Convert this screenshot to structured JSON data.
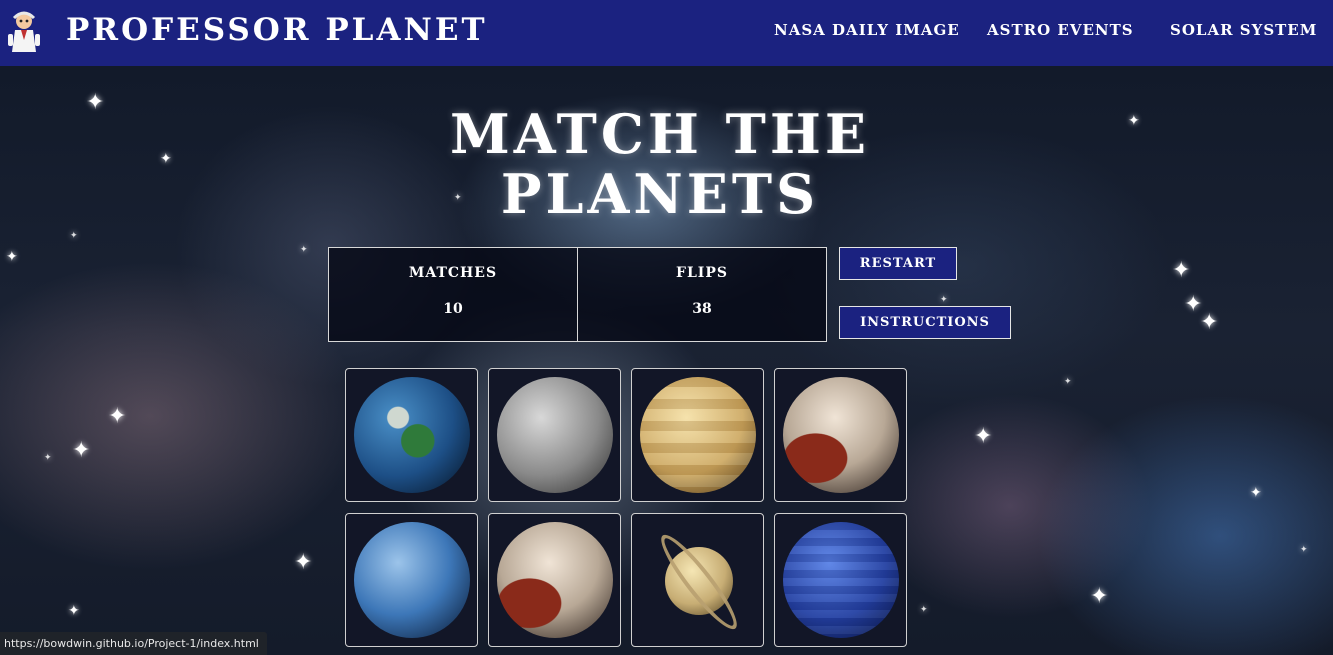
{
  "nav": {
    "brand": "PROFESSOR PLANET",
    "links": [
      "NASA DAILY IMAGE",
      "ASTRO EVENTS",
      "SOLAR SYSTEM"
    ]
  },
  "game": {
    "title_line1": "MATCH THE",
    "title_line2": "PLANETS",
    "matches_label": "MATCHES",
    "matches_value": "10",
    "flips_label": "FLIPS",
    "flips_value": "38",
    "restart_label": "RESTART",
    "instructions_label": "INSTRUCTIONS"
  },
  "cards": [
    {
      "planet": "earth"
    },
    {
      "planet": "moon"
    },
    {
      "planet": "venus"
    },
    {
      "planet": "pluto"
    },
    {
      "planet": "neptune"
    },
    {
      "planet": "pluto"
    },
    {
      "planet": "saturn"
    },
    {
      "planet": "uranus"
    }
  ],
  "status_url": "https://bowdwin.github.io/Project-1/index.html",
  "colors": {
    "navbar": "#1b2280",
    "button": "#1b2280",
    "text": "#ffffff"
  }
}
